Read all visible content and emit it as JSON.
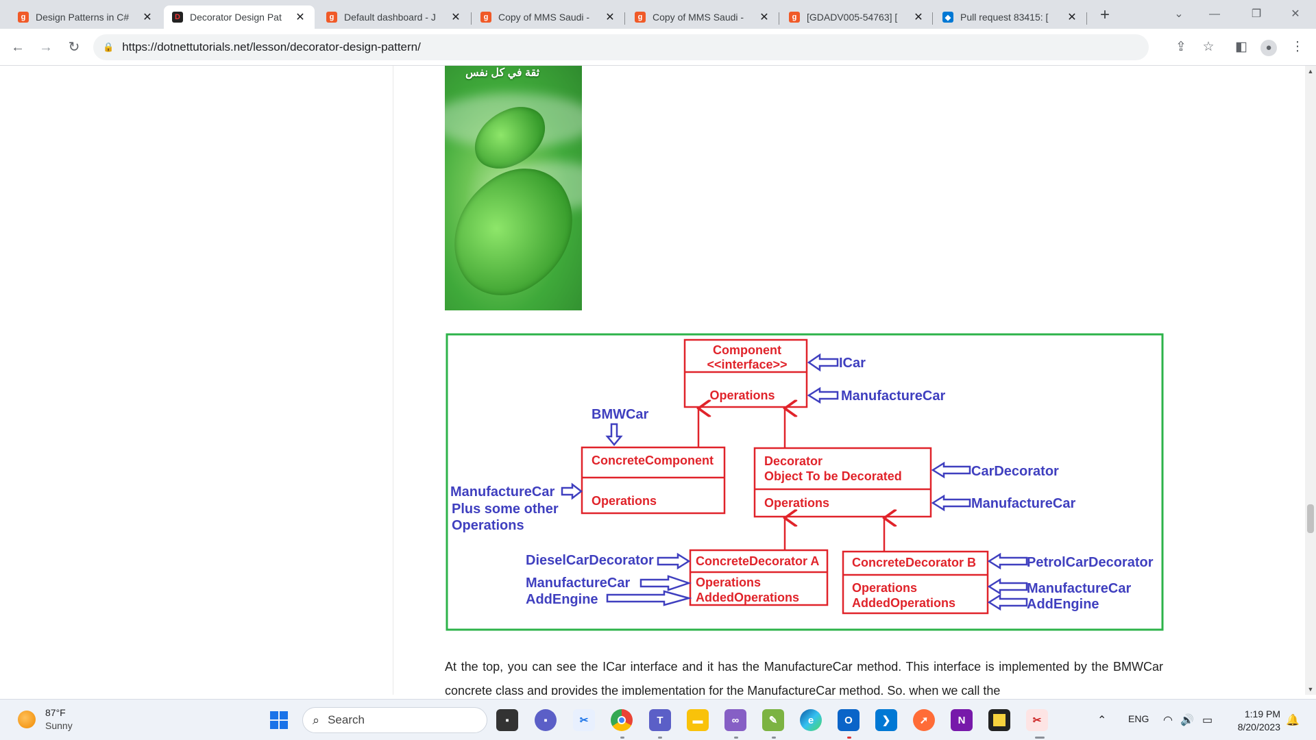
{
  "browser": {
    "tabs": [
      {
        "title": "Design Patterns in C#",
        "favicon": "dotnettutorials-icon",
        "color": "#f05a28",
        "active": false
      },
      {
        "title": "Decorator Design Pat",
        "favicon": "dotnettutorials-dark-icon",
        "color": "#b3261e",
        "active": true
      },
      {
        "title": "Default dashboard - J",
        "favicon": "dotnettutorials-icon",
        "color": "#f05a28",
        "active": false
      },
      {
        "title": "Copy of MMS Saudi -",
        "favicon": "dotnettutorials-icon",
        "color": "#f05a28",
        "active": false
      },
      {
        "title": "Copy of MMS Saudi -",
        "favicon": "dotnettutorials-icon",
        "color": "#f05a28",
        "active": false
      },
      {
        "title": "[GDADV005-54763] [",
        "favicon": "dotnettutorials-icon",
        "color": "#f05a28",
        "active": false
      },
      {
        "title": "Pull request 83415: [",
        "favicon": "azure-devops-icon",
        "color": "#0078d4",
        "active": false
      }
    ],
    "url": "https://dotnettutorials.net/lesson/decorator-design-pattern/"
  },
  "ad": {
    "arabic_text": "ثقة في كل نفس"
  },
  "diagram": {
    "component": {
      "line1": "Component",
      "line2": "<<interface>>",
      "ops": "Operations"
    },
    "concrete_component": {
      "title": "ConcreteComponent",
      "ops": "Operations"
    },
    "decorator": {
      "line1": "Decorator",
      "line2": "Object To be Decorated",
      "ops": "Operations"
    },
    "concrete_decorator_a": {
      "title": "ConcreteDecorator A",
      "ops1": "Operations",
      "ops2": "AddedOperations"
    },
    "concrete_decorator_b": {
      "title": "ConcreteDecorator B",
      "ops1": "Operations",
      "ops2": "AddedOperations"
    },
    "labels": {
      "icar": "ICar",
      "manufacture_car_top": "ManufactureCar",
      "bmwcar": "BMWCar",
      "manufacture_car_left": "ManufactureCar",
      "plus_some_other": "Plus some other",
      "operations_left": "Operations",
      "car_decorator": "CarDecorator",
      "manufacture_car_right": "ManufactureCar",
      "diesel_car_decorator": "DieselCarDecorator",
      "manufacture_car_a": "ManufactureCar",
      "add_engine_a": "AddEngine",
      "petrol_car_decorator": "PetrolCarDecorator",
      "manufacture_car_b": "ManufactureCar",
      "add_engine_b": "AddEngine"
    },
    "colors": {
      "box": "#e0232a",
      "label": "#3f3fbf",
      "frame": "#2db34a"
    }
  },
  "article": {
    "paragraph": "At the top, you can see the ICar interface and it has the ManufactureCar method. This interface is implemented by the BMWCar concrete class and provides the implementation for the ManufactureCar method. So, when we call the"
  },
  "taskbar": {
    "weather_temp": "87°F",
    "weather_cond": "Sunny",
    "search_placeholder": "Search",
    "apps": [
      "file-explorer-icon",
      "teams-chat-icon",
      "snipping-icon",
      "chrome-icon",
      "teams-icon",
      "folder-icon",
      "visual-studio-icon",
      "notepad-plus-icon",
      "edge-icon",
      "outlook-icon",
      "vscode-icon",
      "postman-icon",
      "onenote-icon",
      "sticky-notes-icon",
      "snipping-tool-icon"
    ],
    "lang": "ENG",
    "time": "1:19 PM",
    "date": "8/20/2023"
  }
}
